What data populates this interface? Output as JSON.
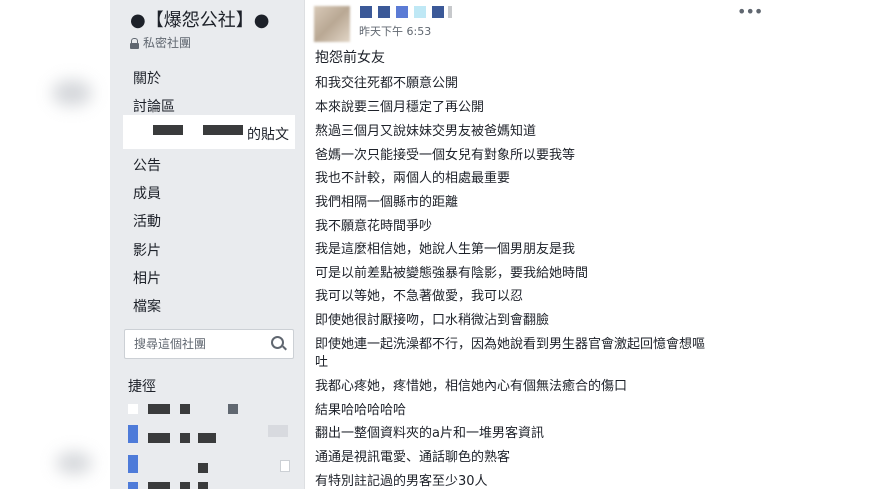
{
  "group": {
    "title": "●【爆怨公社】●",
    "privacy": "私密社團"
  },
  "nav": {
    "about": "關於",
    "discussion": "討論區",
    "active_suffix": "的貼文",
    "announcements": "公告",
    "members": "成員",
    "events": "活動",
    "videos": "影片",
    "photos": "相片",
    "files": "檔案"
  },
  "search": {
    "placeholder": "搜尋這個社團"
  },
  "shortcuts": {
    "label": "捷徑"
  },
  "post": {
    "timestamp": "昨天下午 6:53",
    "title": "抱怨前女友",
    "lines": [
      "和我交往死都不願意公開",
      "本來說要三個月穩定了再公開",
      "熬過三個月又說妹妹交男友被爸媽知道",
      "爸媽一次只能接受一個女兒有對象所以要我等",
      "我也不計較，兩個人的相處最重要",
      "我們相隔一個縣市的距離",
      "我不願意花時間爭吵",
      "我是這麼相信她，她說人生第一個男朋友是我",
      "可是以前差點被變態強暴有陰影，要我給她時間",
      "我可以等她，不急著做愛，我可以忍",
      "即使她很討厭接吻，口水稍微沾到會翻臉",
      "即使她連一起洗澡都不行，因為她說看到男生器官會激起回憶會想嘔",
      "吐",
      "我都心疼她，疼惜她，相信她內心有個無法癒合的傷口",
      "結果哈哈哈哈哈",
      "翻出一整個資料夾的a片和一堆男客資訊",
      "通通是視訊電愛、通話聊色的熟客",
      "有特別註記過的男客至少30人"
    ]
  },
  "icons": {
    "lock": "lock-icon",
    "search": "search-icon",
    "more": "more-options-icon"
  },
  "colors": {
    "sidebar_bg": "#e9ebee",
    "text": "#1d2129",
    "muted": "#606770",
    "author_blue": "#3b5998"
  }
}
